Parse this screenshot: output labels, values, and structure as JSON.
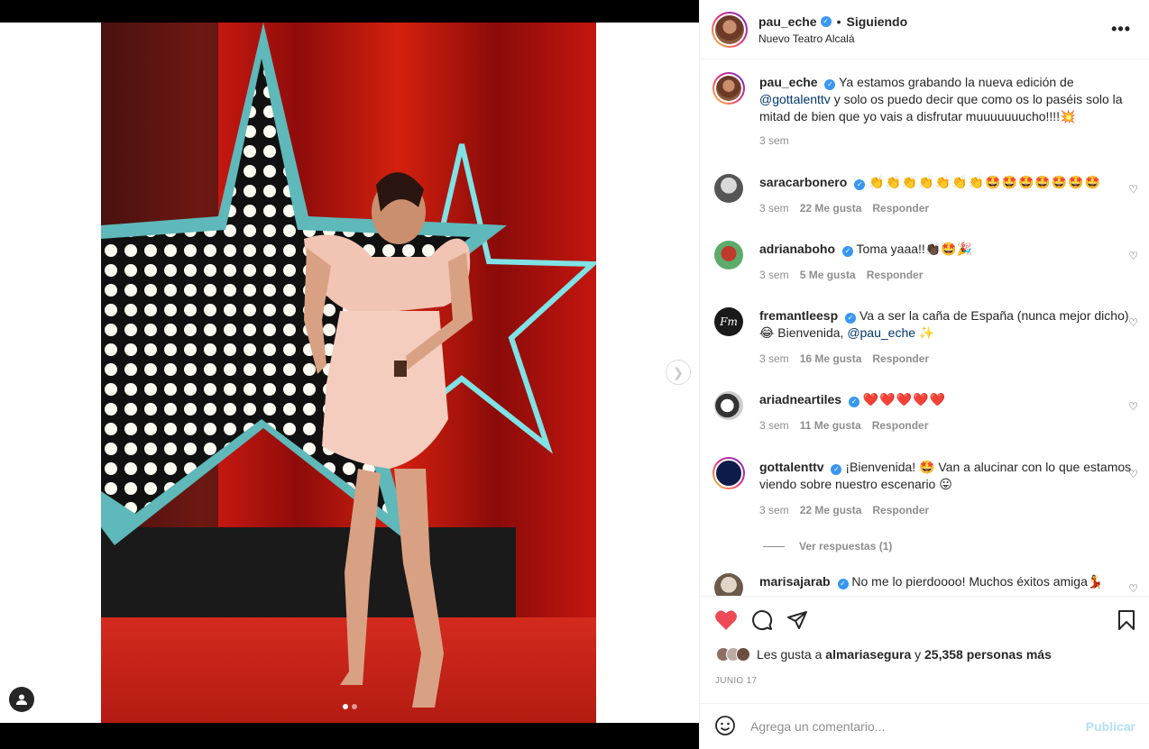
{
  "post": {
    "username": "pau_eche",
    "separator": "•",
    "follow_status": "Siguiendo",
    "location": "Nuevo Teatro Alcalá",
    "more_label": "•••"
  },
  "caption": {
    "username": "pau_eche",
    "text_before": "Ya estamos grabando la nueva edición de",
    "mention": "@gottalenttv",
    "text_after": "y solo os puedo decir que como os lo paséis solo la mitad de bien que yo vais a disfrutar muuuuuuucho!!!!💥",
    "time": "3 sem"
  },
  "comments": [
    {
      "username": "saracarbonero",
      "text": "👏👏👏👏👏👏👏🤩🤩🤩🤩🤩🤩🤩",
      "time": "3 sem",
      "likes": "22 Me gusta",
      "reply": "Responder"
    },
    {
      "username": "adrianaboho",
      "text": "Toma yaaa!!👏🏿🤩🎉",
      "time": "3 sem",
      "likes": "5 Me gusta",
      "reply": "Responder"
    },
    {
      "username": "fremantleesp",
      "text": "Va a ser la caña de España (nunca mejor dicho) 😂 Bienvenida,",
      "mention": "@pau_eche",
      "suffix": "✨",
      "time": "3 sem",
      "likes": "16 Me gusta",
      "reply": "Responder"
    },
    {
      "username": "ariadneartiles",
      "text": "❤️❤️❤️❤️❤️",
      "time": "3 sem",
      "likes": "11 Me gusta",
      "reply": "Responder"
    },
    {
      "username": "gottalenttv",
      "text": "¡Bienvenida! 🤩 Van a alucinar con lo que estamos viendo sobre nuestro escenario 😛",
      "time": "3 sem",
      "likes": "22 Me gusta",
      "reply": "Responder"
    },
    {
      "username": "marisajarab",
      "text": "No me lo pierdoooo! Muchos éxitos amiga💃"
    }
  ],
  "view_replies": "Ver respuestas (1)",
  "likes": {
    "prefix": "Les gusta a",
    "user": "almariasegura",
    "middle": "y",
    "count": "25,358 personas más"
  },
  "date": "JUNIO 17",
  "add_comment": {
    "placeholder": "Agrega un comentario...",
    "publish_label": "Publicar"
  },
  "colors": {
    "like_red": "#ed4956",
    "verified_blue": "#3897f0",
    "publish_disabled": "#b2dffc",
    "curtain_red": "#c8160f",
    "star_cyan": "#6fd3d8"
  },
  "carousel": {
    "slides": 2,
    "current": 1
  }
}
